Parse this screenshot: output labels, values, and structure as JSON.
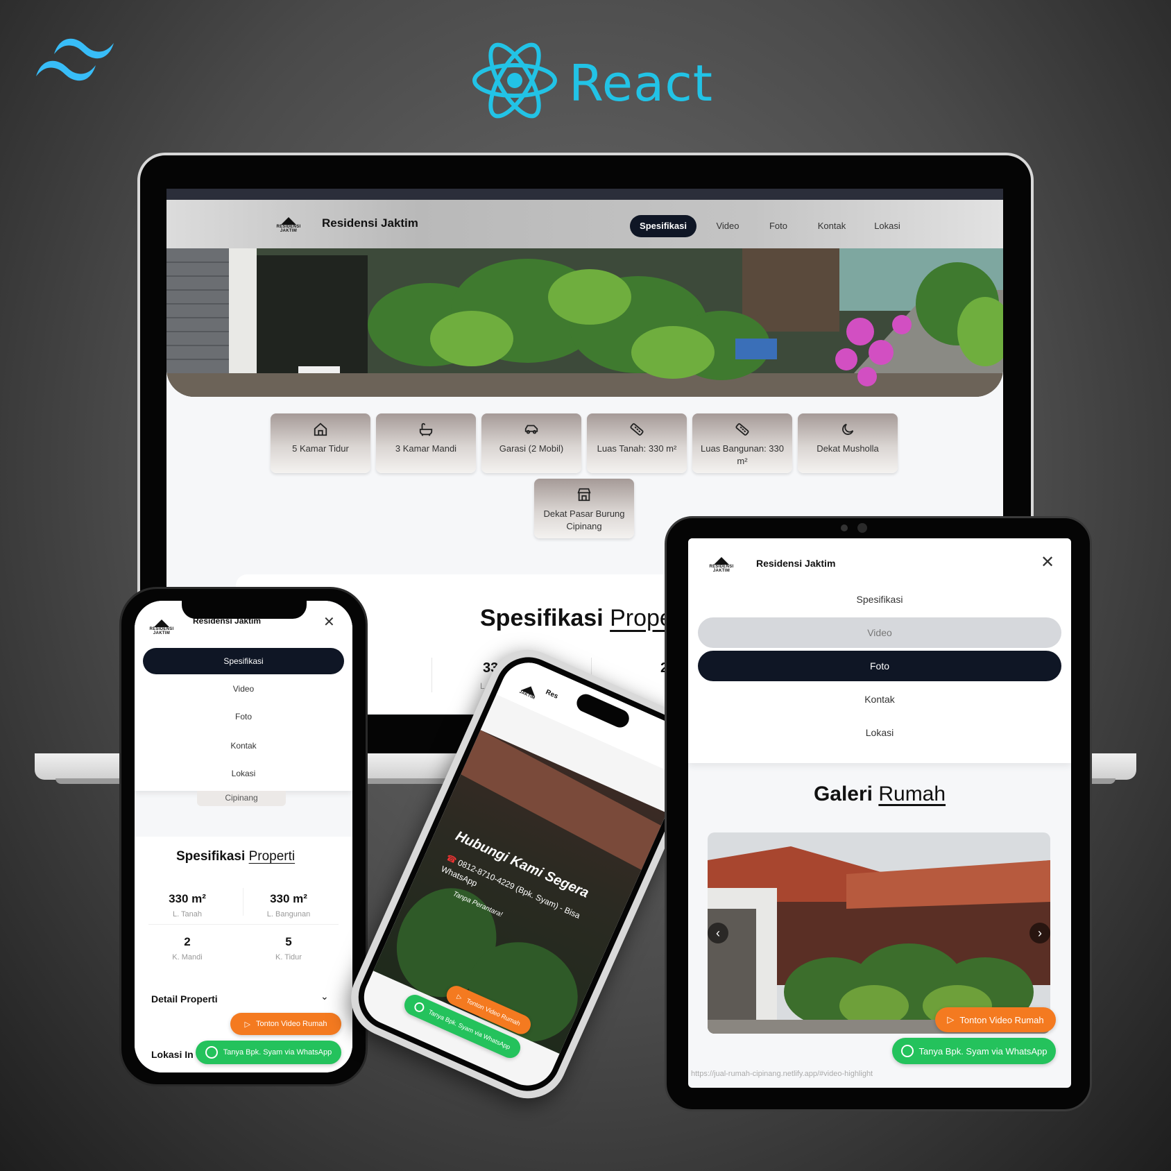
{
  "react_logo": {
    "label": "React",
    "color": "#22c3e6"
  },
  "brand": {
    "name": "Residensi Jaktim",
    "logo_line1": "RESIDENSI",
    "logo_line2": "JAKTIM"
  },
  "nav": {
    "items": [
      "Spesifikasi",
      "Video",
      "Foto",
      "Kontak",
      "Lokasi"
    ],
    "active": "Spesifikasi"
  },
  "features": [
    {
      "icon": "home-icon",
      "label": "5 Kamar Tidur"
    },
    {
      "icon": "bath-icon",
      "label": "3 Kamar Mandi"
    },
    {
      "icon": "car-icon",
      "label": "Garasi (2 Mobil)"
    },
    {
      "icon": "ruler-icon",
      "label": "Luas Tanah: 330 m²"
    },
    {
      "icon": "ruler-icon",
      "label": "Luas Bangunan: 330 m²"
    },
    {
      "icon": "moon-icon",
      "label": "Dekat Musholla"
    },
    {
      "icon": "store-icon",
      "label": "Dekat Pasar Burung Cipinang"
    }
  ],
  "spec_section": {
    "title_bold": "Spesifikasi",
    "title_underlined": "Properti",
    "laptop_title_underlined": "Prope",
    "laptop_stat_value": "330 m²",
    "laptop_stat_value_cut": "2",
    "laptop_stat_label": "L. Ban"
  },
  "mobile": {
    "menu": [
      "Spesifikasi",
      "Video",
      "Foto",
      "Kontak",
      "Lokasi"
    ],
    "menu_active": "Spesifikasi",
    "behind_text": "Cipinang",
    "stats": [
      {
        "value": "330 m²",
        "label": "L. Tanah"
      },
      {
        "value": "330 m²",
        "label": "L. Bangunan"
      },
      {
        "value": "2",
        "label": "K. Mandi"
      },
      {
        "value": "5",
        "label": "K. Tidur"
      }
    ],
    "detail_heading": "Detail Properti",
    "lokasi_heading": "Lokasi In"
  },
  "buttons": {
    "video": "Tonton Video Rumah",
    "whatsapp": "Tanya Bpk. Syam via WhatsApp"
  },
  "contact": {
    "title": "Hubungi Kami Segera",
    "phone": "0812-8710-4229 (Bpk. Syam) - Bisa WhatsApp",
    "note": "Tanpa Perantara!",
    "brand_cut": "Res"
  },
  "tablet": {
    "menu": [
      "Spesifikasi",
      "Video",
      "Foto",
      "Kontak",
      "Lokasi"
    ],
    "menu_hover": "Video",
    "menu_active": "Foto",
    "gallery_bold": "Galeri",
    "gallery_underlined": "Rumah",
    "status_url": "https://jual-rumah-cipinang.netlify.app/#video-highlight"
  },
  "colors": {
    "navy": "#0f1625",
    "orange": "#f47a20",
    "green": "#24c25c",
    "react": "#22c3e6"
  }
}
